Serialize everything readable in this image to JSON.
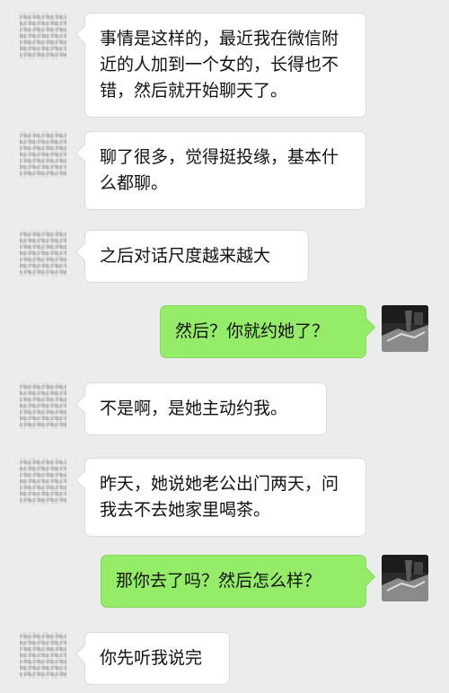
{
  "chat": {
    "messages": [
      {
        "sender": "contact",
        "avatar": "pixelated-avatar-icon",
        "text": "事情是这样的，最近我在微信附近的人加到一个女的，长得也不错，然后就开始聊天了。"
      },
      {
        "sender": "contact",
        "avatar": "pixelated-avatar-icon",
        "text": "聊了很多，觉得挺投缘，基本什么都聊。"
      },
      {
        "sender": "contact",
        "avatar": "pixelated-avatar-icon",
        "text": "之后对话尺度越来越大"
      },
      {
        "sender": "self",
        "avatar": "dark-photo-avatar-icon",
        "text": "然后？你就约她了？"
      },
      {
        "sender": "contact",
        "avatar": "pixelated-avatar-icon",
        "text": "不是啊，是她主动约我。"
      },
      {
        "sender": "contact",
        "avatar": "pixelated-avatar-icon",
        "text": "昨天，她说她老公出门两天，问我去不去她家里喝茶。"
      },
      {
        "sender": "self",
        "avatar": "dark-photo-avatar-icon",
        "text": "那你去了吗？然后怎么样？"
      },
      {
        "sender": "contact",
        "avatar": "pixelated-avatar-icon",
        "text": "你先听我说完"
      }
    ]
  },
  "colors": {
    "background": "#ececec",
    "incoming_bubble": "#ffffff",
    "outgoing_bubble": "#95ec69",
    "text": "#111111"
  }
}
